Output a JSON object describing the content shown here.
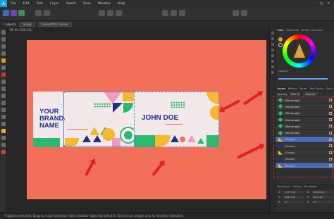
{
  "app": {
    "logo": "A"
  },
  "menu": [
    "File",
    "Edit",
    "Text",
    "Layer",
    "Select",
    "View",
    "Window",
    "Help"
  ],
  "window_controls": [
    "–",
    "□",
    "✕"
  ],
  "context": {
    "objects": "7 objects",
    "group": "Group",
    "convert": "Convert to Curves"
  },
  "document": {
    "tab": "BC Kit (136.3%)"
  },
  "card1": {
    "line1": "YOUR",
    "line2": "BRAND",
    "line3": "NAME"
  },
  "card2": {
    "name": "JOHN DOE"
  },
  "panel": {
    "color_tabs": [
      "Color",
      "Swatches",
      "Stroke",
      "Brushes"
    ],
    "opacity_label": "Opacity",
    "layer_tabs": [
      "Layers",
      "Effects",
      "Styles",
      "Text Styles",
      "Stock"
    ],
    "opacity_field": "100 %",
    "blend_mode": "Normal",
    "layers": [
      {
        "name": "(Rectangle)",
        "type": "diamond",
        "selected": false
      },
      {
        "name": "(Rectangle)",
        "type": "diamond",
        "selected": false
      },
      {
        "name": "(Rectangle)",
        "type": "diamond",
        "selected": false
      },
      {
        "name": "(Rectangle)",
        "type": "diamond",
        "selected": false
      },
      {
        "name": "(Rectangle)",
        "type": "diamond",
        "selected": false
      },
      {
        "name": "(Rectangle)",
        "type": "diamond",
        "selected": false
      },
      {
        "name": "(Curve)",
        "type": "curve",
        "selected": true
      },
      {
        "name": "(Curve)",
        "type": "curve",
        "selected": false
      },
      {
        "name": "(Curve)",
        "type": "curve",
        "selected": false
      },
      {
        "name": "(Curve)",
        "type": "curve",
        "selected": false
      },
      {
        "name": "(Curve)",
        "type": "curve",
        "selected": true
      }
    ],
    "transform_tabs": [
      "Transform",
      "History",
      "Navigator"
    ],
    "transform": {
      "x_label": "X:",
      "x": "179.7 pt",
      "w_label": "W:",
      "w": "404.6 pt",
      "y_label": "Y:",
      "y": "184.2 pt",
      "h_label": "H:",
      "h": "44.3 pt",
      "r_label": "R:",
      "r": "0 °",
      "s_label": "S:",
      "s": "0 °"
    }
  },
  "status": "7 objects selected. Drag to move selection. Click another object to select it. Click on an empty area to deselect selection.",
  "colors": {
    "accent": "#4a8de8",
    "artboard": "#f2705a",
    "navy": "#1e2e8a",
    "green": "#2cb86e",
    "yellow": "#f5b82e",
    "pink": "#f29ac0",
    "arrow": "#e2202a"
  }
}
